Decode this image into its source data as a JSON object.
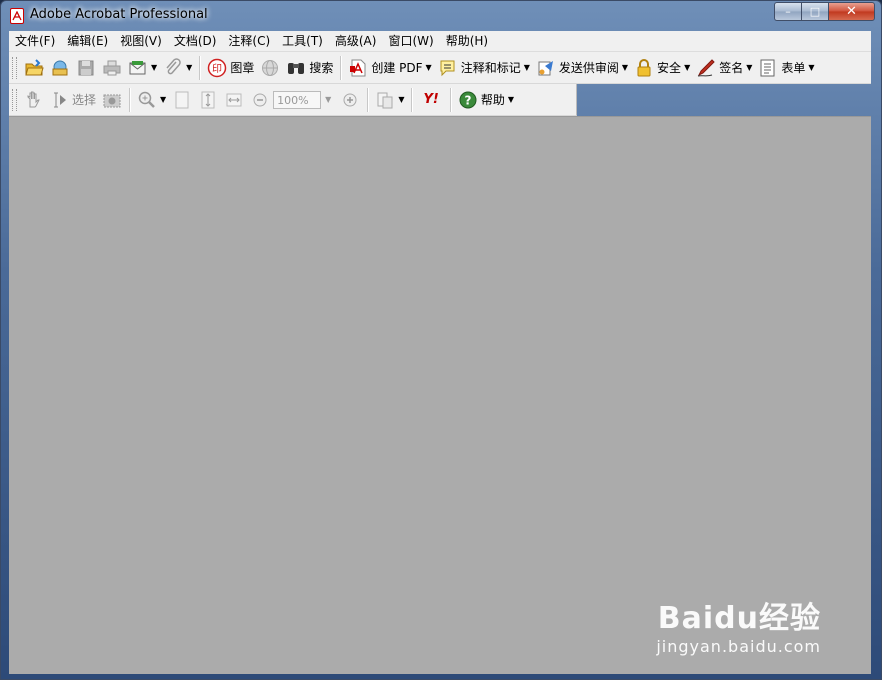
{
  "window": {
    "title": "Adobe Acrobat Professional",
    "controls": {
      "minimize": "–",
      "maximize": "□",
      "close": "✕"
    }
  },
  "menu": [
    {
      "label": "文件(F)"
    },
    {
      "label": "编辑(E)"
    },
    {
      "label": "视图(V)"
    },
    {
      "label": "文档(D)"
    },
    {
      "label": "注释(C)"
    },
    {
      "label": "工具(T)"
    },
    {
      "label": "高级(A)"
    },
    {
      "label": "窗口(W)"
    },
    {
      "label": "帮助(H)"
    }
  ],
  "toolbar1": {
    "stamp_label": "图章",
    "search_label": "搜索",
    "create_pdf_label": "创建 PDF",
    "comment_label": "注释和标记",
    "review_label": "发送供审阅",
    "security_label": "安全",
    "sign_label": "签名",
    "forms_label": "表单"
  },
  "toolbar2": {
    "select_label": "选择",
    "zoom_value": "100%",
    "help_label": "帮助",
    "yahoo_label": "Y!"
  },
  "watermark": {
    "brand": "Baidu经验",
    "url": "jingyan.baidu.com"
  },
  "colors": {
    "workspace": "#ababab",
    "toolbar": "#f0f0f0",
    "acrobat_red": "#cc0000"
  }
}
